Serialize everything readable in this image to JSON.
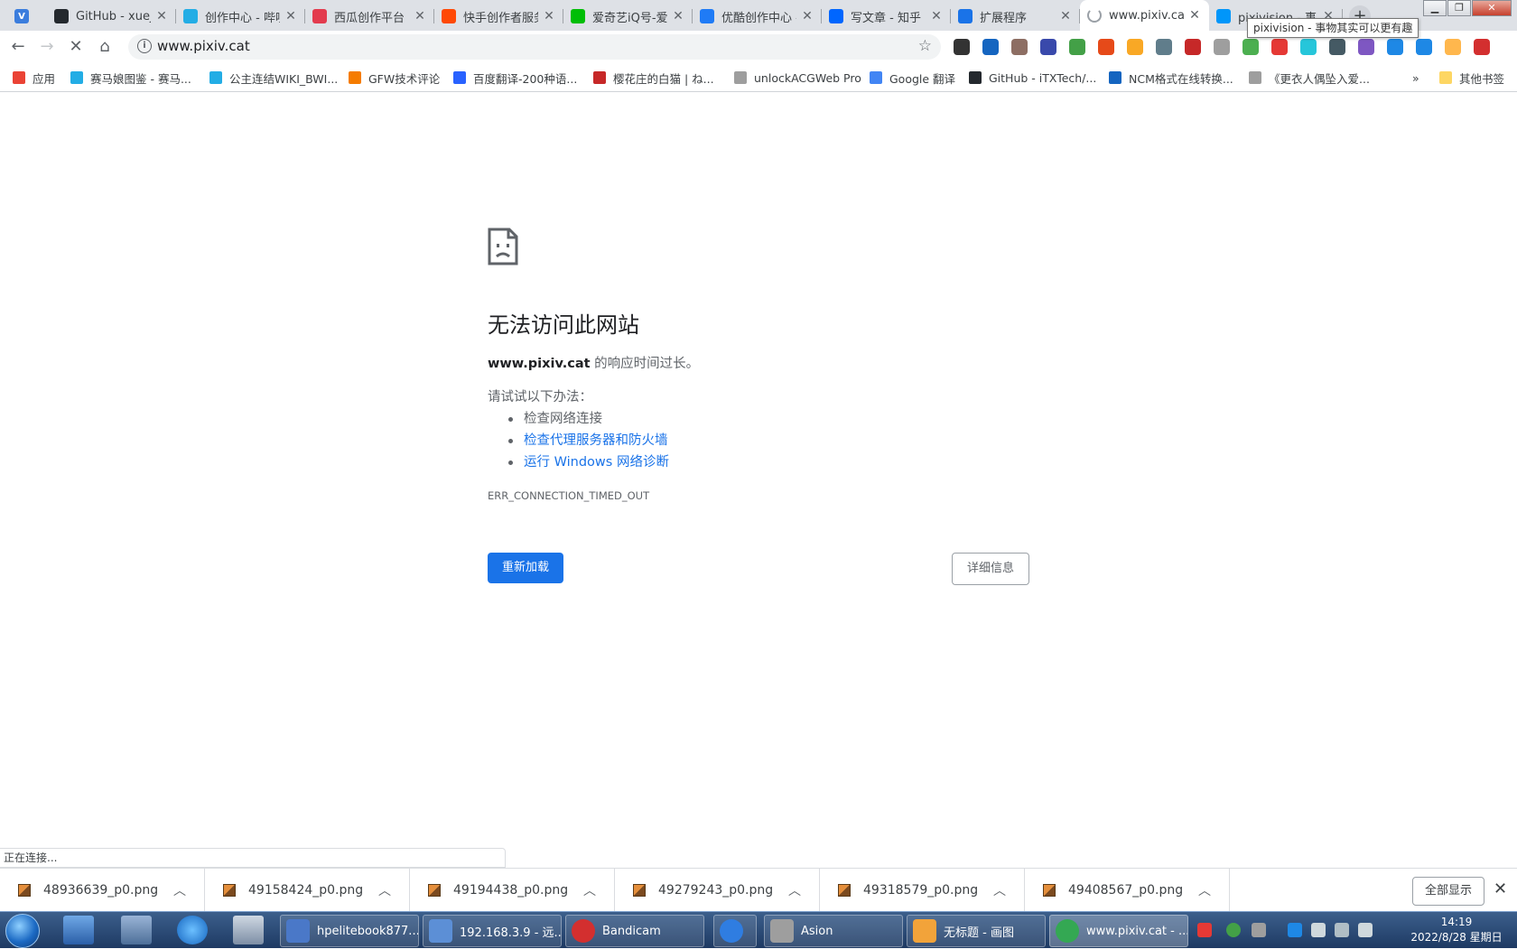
{
  "tabs": [
    {
      "title": "GitHub - xuejin",
      "color": "#24292e"
    },
    {
      "title": "创作中心 - 哔哩",
      "color": "#23ade5"
    },
    {
      "title": "西瓜创作平台",
      "color": "#e33b4e"
    },
    {
      "title": "快手创作者服务",
      "color": "#ff4906"
    },
    {
      "title": "爱奇艺iQ号-爱",
      "color": "#00be06"
    },
    {
      "title": "优酷创作中心 - ",
      "color": "#1f7bf6"
    },
    {
      "title": "写文章 - 知乎",
      "color": "#0066ff"
    },
    {
      "title": "扩展程序",
      "color": "#1a73e8"
    },
    {
      "title": "www.pixiv.cat",
      "color": "#9aa0a6"
    },
    {
      "title": "pixivision - 事",
      "color": "#0096fa"
    }
  ],
  "tooltip": "pixivision - 事物其实可以更有趣",
  "omnibox": {
    "url": "www.pixiv.cat"
  },
  "bookmarks": [
    "应用",
    "赛马娘图鉴 - 赛马...",
    "公主连结WIKI_BWI...",
    "GFW技术评论",
    "百度翻译-200种语...",
    "樱花庄的白猫 | ね...",
    "unlockACGWeb Pro",
    "Google 翻译",
    "GitHub - iTXTech/...",
    "NCM格式在线转换...",
    "《更衣人偶坠入爱...",
    "其他书签"
  ],
  "error": {
    "title": "无法访问此网站",
    "host": "www.pixiv.cat",
    "desc_suffix": " 的响应时间过长。",
    "try_label": "请试试以下办法：",
    "suggestions": [
      "检查网络连接",
      "检查代理服务器和防火墙",
      "运行 Windows 网络诊断"
    ],
    "code": "ERR_CONNECTION_TIMED_OUT",
    "reload": "重新加载",
    "details": "详细信息"
  },
  "status_text": "正在连接...",
  "downloads": [
    "48936639_p0.png",
    "49158424_p0.png",
    "49194438_p0.png",
    "49279243_p0.png",
    "49318579_p0.png",
    "49408567_p0.png"
  ],
  "show_all": "全部显示",
  "taskbar": [
    {
      "label": "hpelitebook877...",
      "color": "#4a78c8"
    },
    {
      "label": "192.168.3.9 - 远...",
      "color": "#5c8fd6"
    },
    {
      "label": "Bandicam",
      "color": "#d32f2f"
    },
    {
      "label": "",
      "color": "#2f7de1"
    },
    {
      "label": "Asion",
      "color": "#9e9e9e"
    },
    {
      "label": "无标题 - 画图",
      "color": "#f2a33a"
    },
    {
      "label": "www.pixiv.cat - ...",
      "color": "#34a853"
    }
  ],
  "clock": {
    "time": "14:19",
    "date": "2022/8/28 星期日"
  }
}
